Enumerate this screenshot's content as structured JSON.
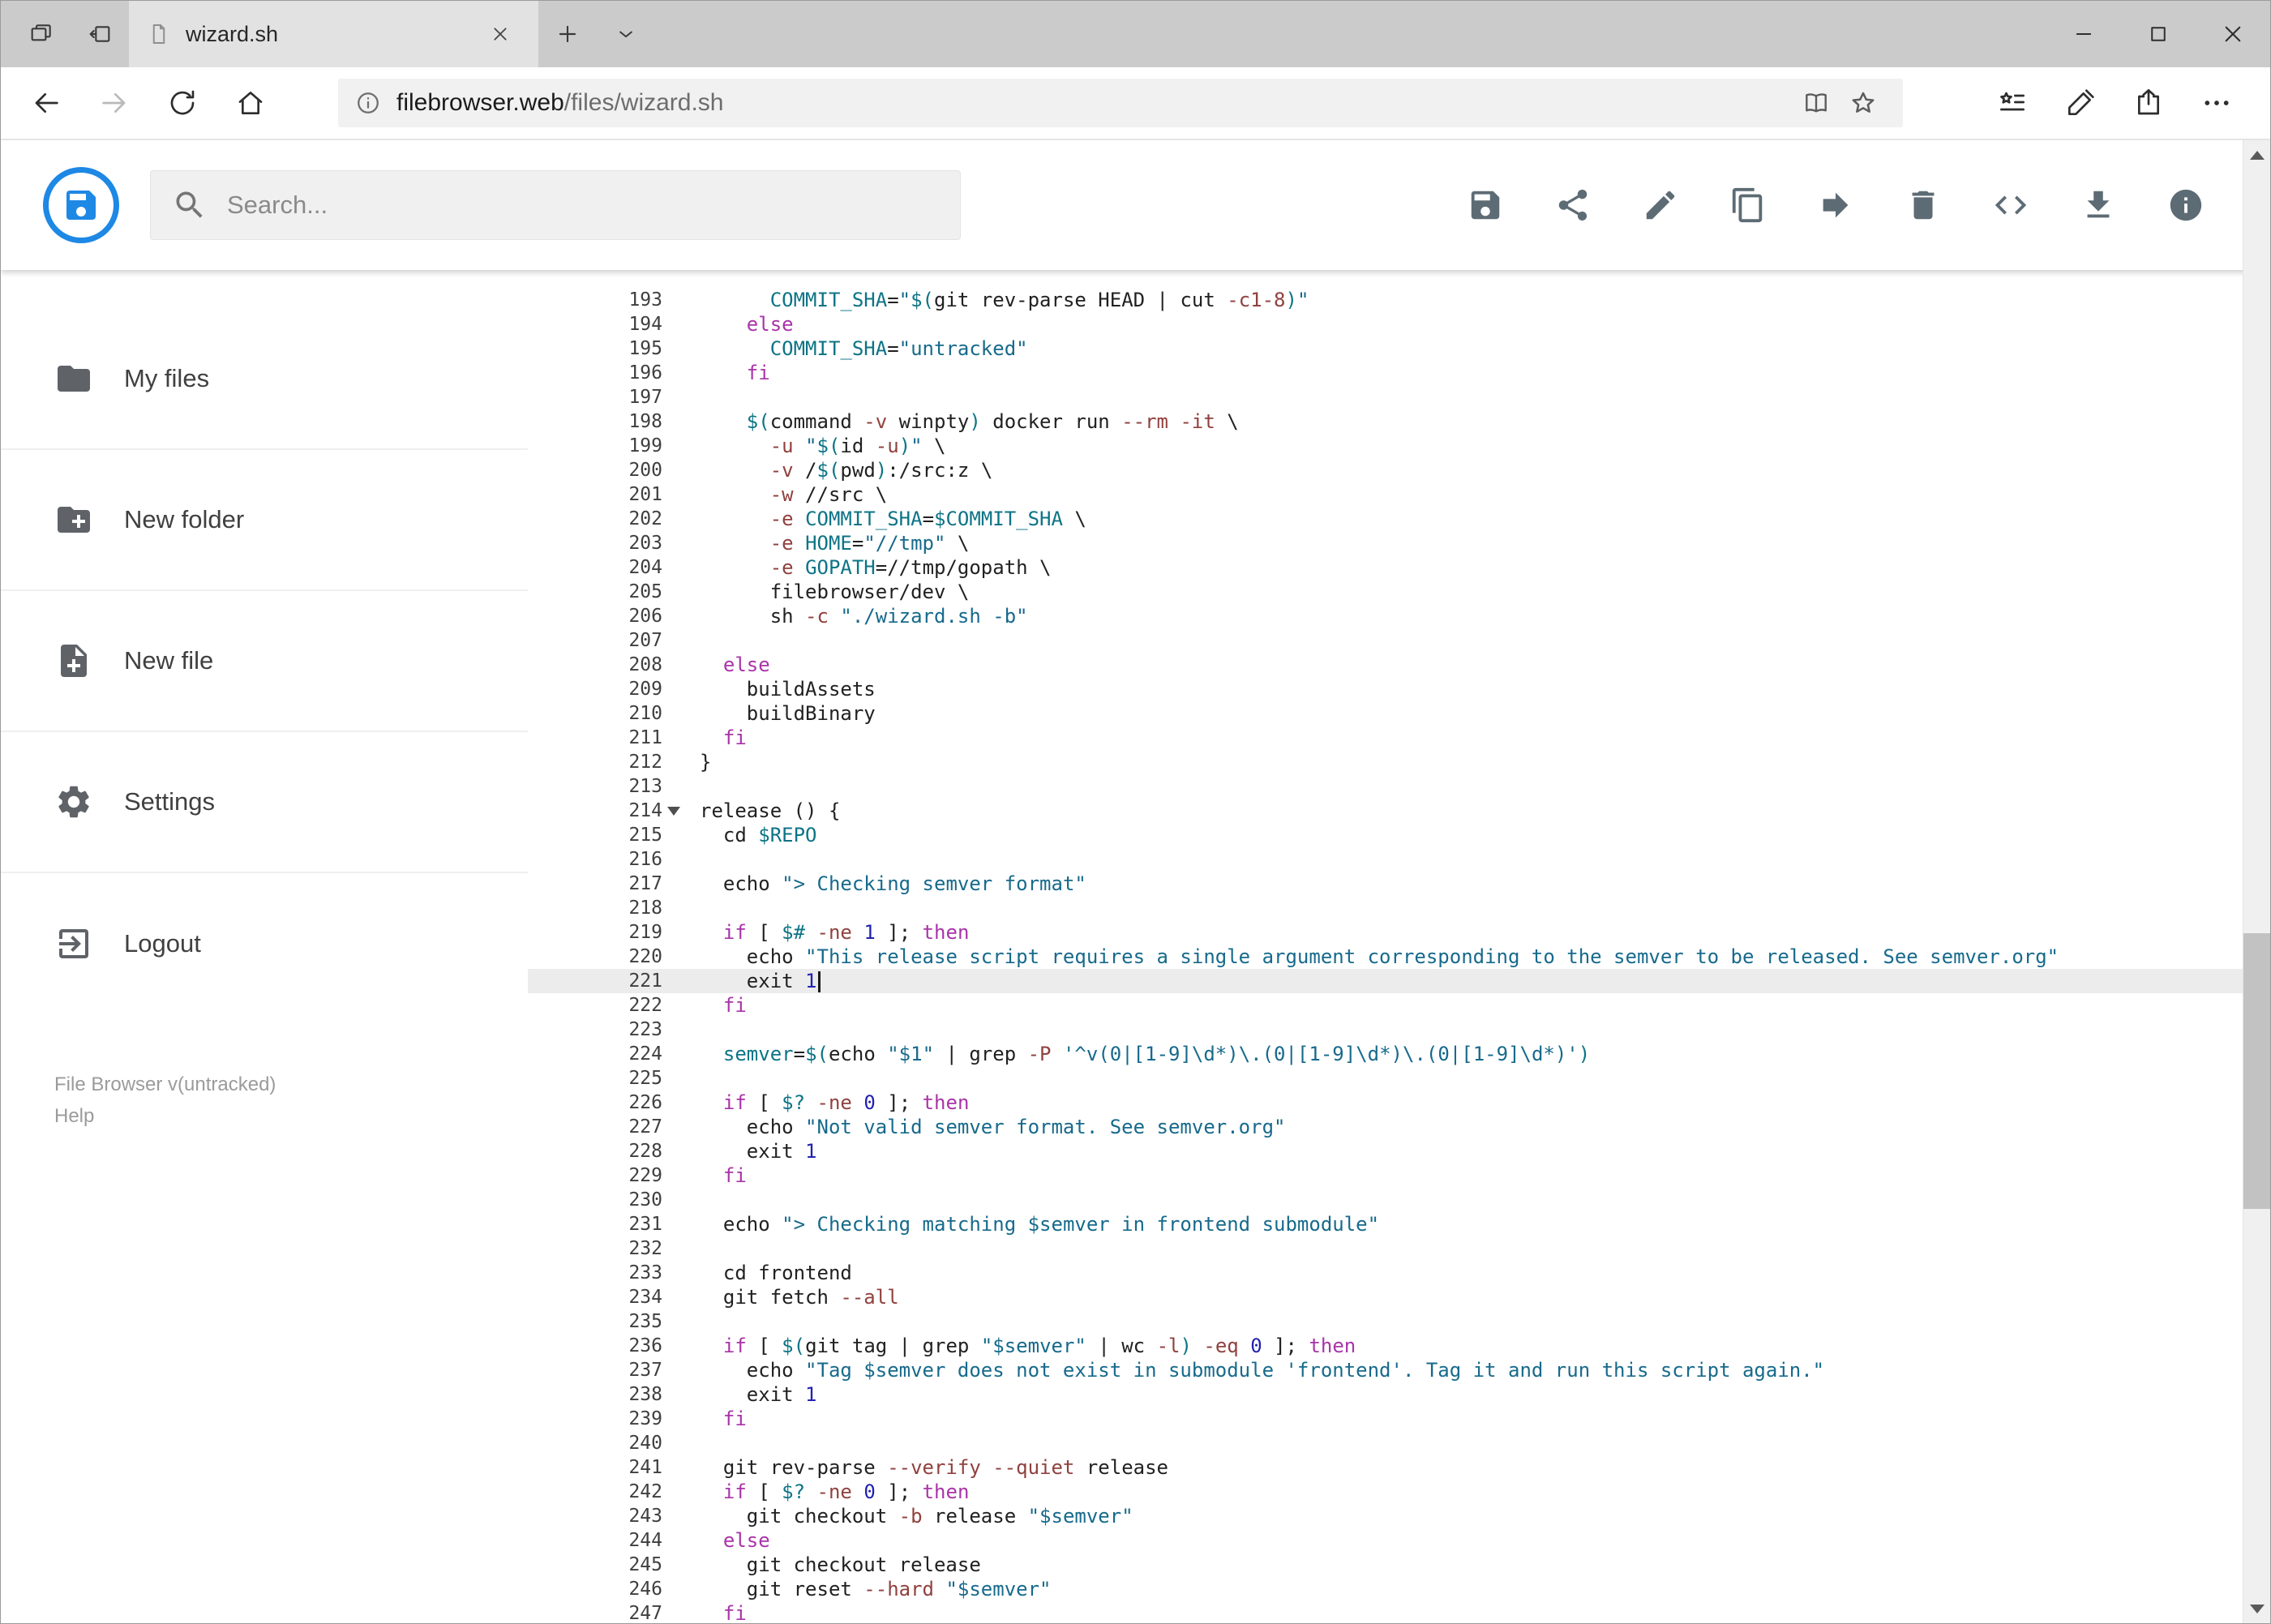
{
  "browser": {
    "tab_title": "wizard.sh",
    "url_host": "filebrowser.web",
    "url_path": "/files/wizard.sh",
    "tabbar_icons": [
      "tab-preview-icon",
      "set-tabs-aside-icon",
      "page-icon",
      "tab-close-icon",
      "new-tab-icon",
      "tab-list-chevron-icon",
      "minimize-icon",
      "maximize-icon",
      "close-icon"
    ],
    "toolbar_icons": [
      "back-icon",
      "forward-icon",
      "refresh-icon",
      "home-icon",
      "page-info-icon",
      "reading-view-icon",
      "favorite-star-icon",
      "hub-icon",
      "ink-pen-icon",
      "share-icon",
      "more-icon"
    ]
  },
  "app": {
    "accent_color": "#1e88e5",
    "search_placeholder": "Search...",
    "toolbar_actions": [
      {
        "name": "save",
        "icon": "save-icon"
      },
      {
        "name": "share",
        "icon": "share-icon"
      },
      {
        "name": "edit",
        "icon": "edit-icon"
      },
      {
        "name": "copy",
        "icon": "copy-icon"
      },
      {
        "name": "move",
        "icon": "move-icon"
      },
      {
        "name": "delete",
        "icon": "delete-icon"
      },
      {
        "name": "raw-view",
        "icon": "code-icon"
      },
      {
        "name": "download",
        "icon": "download-icon"
      },
      {
        "name": "info",
        "icon": "info-icon"
      }
    ]
  },
  "sidebar": {
    "items": [
      {
        "label": "My files",
        "icon": "folder-icon"
      },
      {
        "label": "New folder",
        "icon": "new-folder-icon"
      },
      {
        "label": "New file",
        "icon": "new-file-icon"
      },
      {
        "label": "Settings",
        "icon": "settings-icon"
      },
      {
        "label": "Logout",
        "icon": "logout-icon"
      }
    ],
    "footer_version": "File Browser v(untracked)",
    "footer_help": "Help"
  },
  "editor": {
    "first_line_number": 193,
    "active_line_number": 221,
    "fold_marker_line": 214,
    "syntax_colors": {
      "keyword": "#a934a8",
      "string": "#176a8c",
      "variable": "#0d7486",
      "number": "#2222b0",
      "flag": "#90413e",
      "default": "#212121"
    },
    "lines": [
      "      COMMIT_SHA=\"$(git rev-parse HEAD | cut -c1-8)\"",
      "    else",
      "      COMMIT_SHA=\"untracked\"",
      "    fi",
      "",
      "    $(command -v winpty) docker run --rm -it \\",
      "      -u \"$(id -u)\" \\",
      "      -v /$(pwd):/src:z \\",
      "      -w //src \\",
      "      -e COMMIT_SHA=$COMMIT_SHA \\",
      "      -e HOME=\"//tmp\" \\",
      "      -e GOPATH=//tmp/gopath \\",
      "      filebrowser/dev \\",
      "      sh -c \"./wizard.sh -b\"",
      "",
      "  else",
      "    buildAssets",
      "    buildBinary",
      "  fi",
      "}",
      "",
      "release () {",
      "  cd $REPO",
      "",
      "  echo \"> Checking semver format\"",
      "",
      "  if [ $# -ne 1 ]; then",
      "    echo \"This release script requires a single argument corresponding to the semver to be released. See semver.org\"",
      "    exit 1",
      "  fi",
      "",
      "  semver=$(echo \"$1\" | grep -P '^v(0|[1-9]\\d*)\\.(0|[1-9]\\d*)\\.(0|[1-9]\\d*)')",
      "",
      "  if [ $? -ne 0 ]; then",
      "    echo \"Not valid semver format. See semver.org\"",
      "    exit 1",
      "  fi",
      "",
      "  echo \"> Checking matching $semver in frontend submodule\"",
      "",
      "  cd frontend",
      "  git fetch --all",
      "",
      "  if [ $(git tag | grep \"$semver\" | wc -l) -eq 0 ]; then",
      "    echo \"Tag $semver does not exist in submodule 'frontend'. Tag it and run this script again.\"",
      "    exit 1",
      "  fi",
      "",
      "  git rev-parse --verify --quiet release",
      "  if [ $? -ne 0 ]; then",
      "    git checkout -b release \"$semver\"",
      "  else",
      "    git checkout release",
      "    git reset --hard \"$semver\"",
      "  fi"
    ]
  }
}
